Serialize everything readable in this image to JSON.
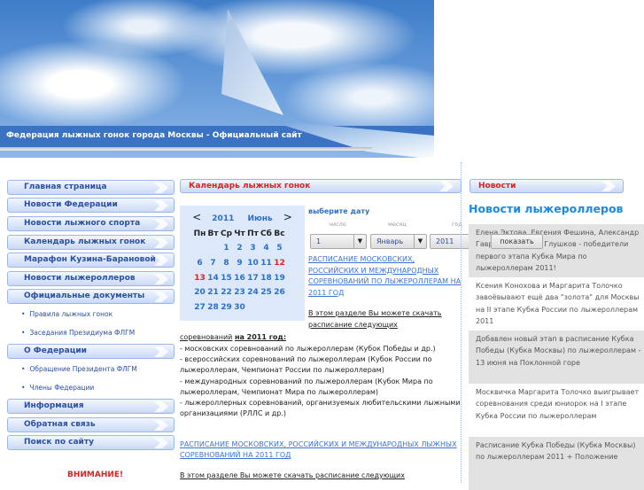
{
  "header": {
    "site_title": "Федерация лыжных гонок города Москвы - Официальный сайт"
  },
  "nav": [
    {
      "label": "Главная страница"
    },
    {
      "label": "Новости Федерации"
    },
    {
      "label": "Новости лыжного спорта"
    },
    {
      "label": "Календарь лыжных гонок"
    },
    {
      "label": "Марафон Кузина-Барановой"
    },
    {
      "label": "Новости лыжероллеров"
    },
    {
      "label": "Официальные документы"
    },
    {
      "label": "Правила лыжных гонок"
    },
    {
      "label": "Заседания Президиума ФЛГМ"
    },
    {
      "label": "О Федерации"
    },
    {
      "label": "Обращение Президента ФЛГМ"
    },
    {
      "label": "Члены Федерации"
    },
    {
      "label": "Информация"
    },
    {
      "label": "Обратная связь"
    },
    {
      "label": "Поиск по сайту"
    }
  ],
  "attention": "ВНИМАНИЕ!",
  "calendar": {
    "header": "Календарь лыжных гонок",
    "year": "2011",
    "month": "Июнь",
    "prev": "<",
    "next": ">",
    "weekdays": [
      "Пн",
      "Вт",
      "Ср",
      "Чт",
      "Пт",
      "Сб",
      "Вс"
    ],
    "weeks": [
      [
        "",
        "",
        "1",
        "2",
        "3",
        "4",
        "5"
      ],
      [
        "6",
        "7",
        "8",
        "9",
        "10",
        "11",
        "12"
      ],
      [
        "13",
        "14",
        "15",
        "16",
        "17",
        "18",
        "19"
      ],
      [
        "20",
        "21",
        "22",
        "23",
        "24",
        "25",
        "26"
      ],
      [
        "27",
        "28",
        "29",
        "30",
        "",
        "",
        ""
      ]
    ],
    "highlighted": [
      "12",
      "13"
    ]
  },
  "date_picker": {
    "title": "выберите дату",
    "day_label": "число",
    "month_label": "месяц",
    "year_label": "год",
    "day": "1",
    "month": "Январь",
    "year": "2011",
    "show_button": "показать"
  },
  "content": {
    "link1": "РАСПИСАНИЕ МОСКОВСКИХ, РОССИЙСКИХ И МЕЖДУНАРОДНЫХ СОРЕВНОВАНИЙ ПО ЛЫЖЕРОЛЛЕРАМ НА 2011 ГОД",
    "intro1a": "В этом разделе Вы можете скачать расписание следующих",
    "intro1b": "соревнований",
    "intro1c": "на 2011 год:",
    "items": [
      "- московских соревнований по лыжероллерам (Кубок Победы и др.)",
      "- всероссийских соревнований по лыжероллерам (Кубок России по лыжероллерам, Чемпионат России по лыжероллерам)",
      "- международных соревнований по лыжероллерам (Кубок Мира по лыжероллерам, Чемпионат Мира по лыжероллерам)",
      "- лыжероллерных соревнований, организуемых любительскими лыжными организациями (РЛЛС и др.)"
    ],
    "link2": "РАСПИСАНИЕ МОСКОВСКИХ, РОССИЙСКИХ И МЕЖДУНАРОДНЫХ ЛЫЖНЫХ СОРЕВНОВАНИЙ НА 2011 ГОД",
    "intro2": "В этом разделе Вы можете скачать расписание следующих"
  },
  "news": {
    "header": "Новости",
    "title": "Новости лыжероллеров",
    "items": [
      "Елена Эктова, Евгения Фешина, Александр Гаврилов и Игорь Глушков - победители первого этапа Кубка Мира по лыжероллерам 2011!",
      "Ксения Конохова и Маргарита Толочко завоёвывают ещё два \"золота\" для Москвы на II этапе Кубка России по лыжероллерам 2011",
      "Добавлен новый этап в расписание Кубка Победы (Кубка Москвы) по лыжероллерам - 13 июня на Поклонной горе",
      "Москвичка Маргарита Толочко выигрывает соревнования среди юниорок на I этапе Кубка России по лыжероллерам",
      "Расписание Кубка Победы (Кубка Москвы) по лыжероллерам 2011 + Положение"
    ]
  }
}
